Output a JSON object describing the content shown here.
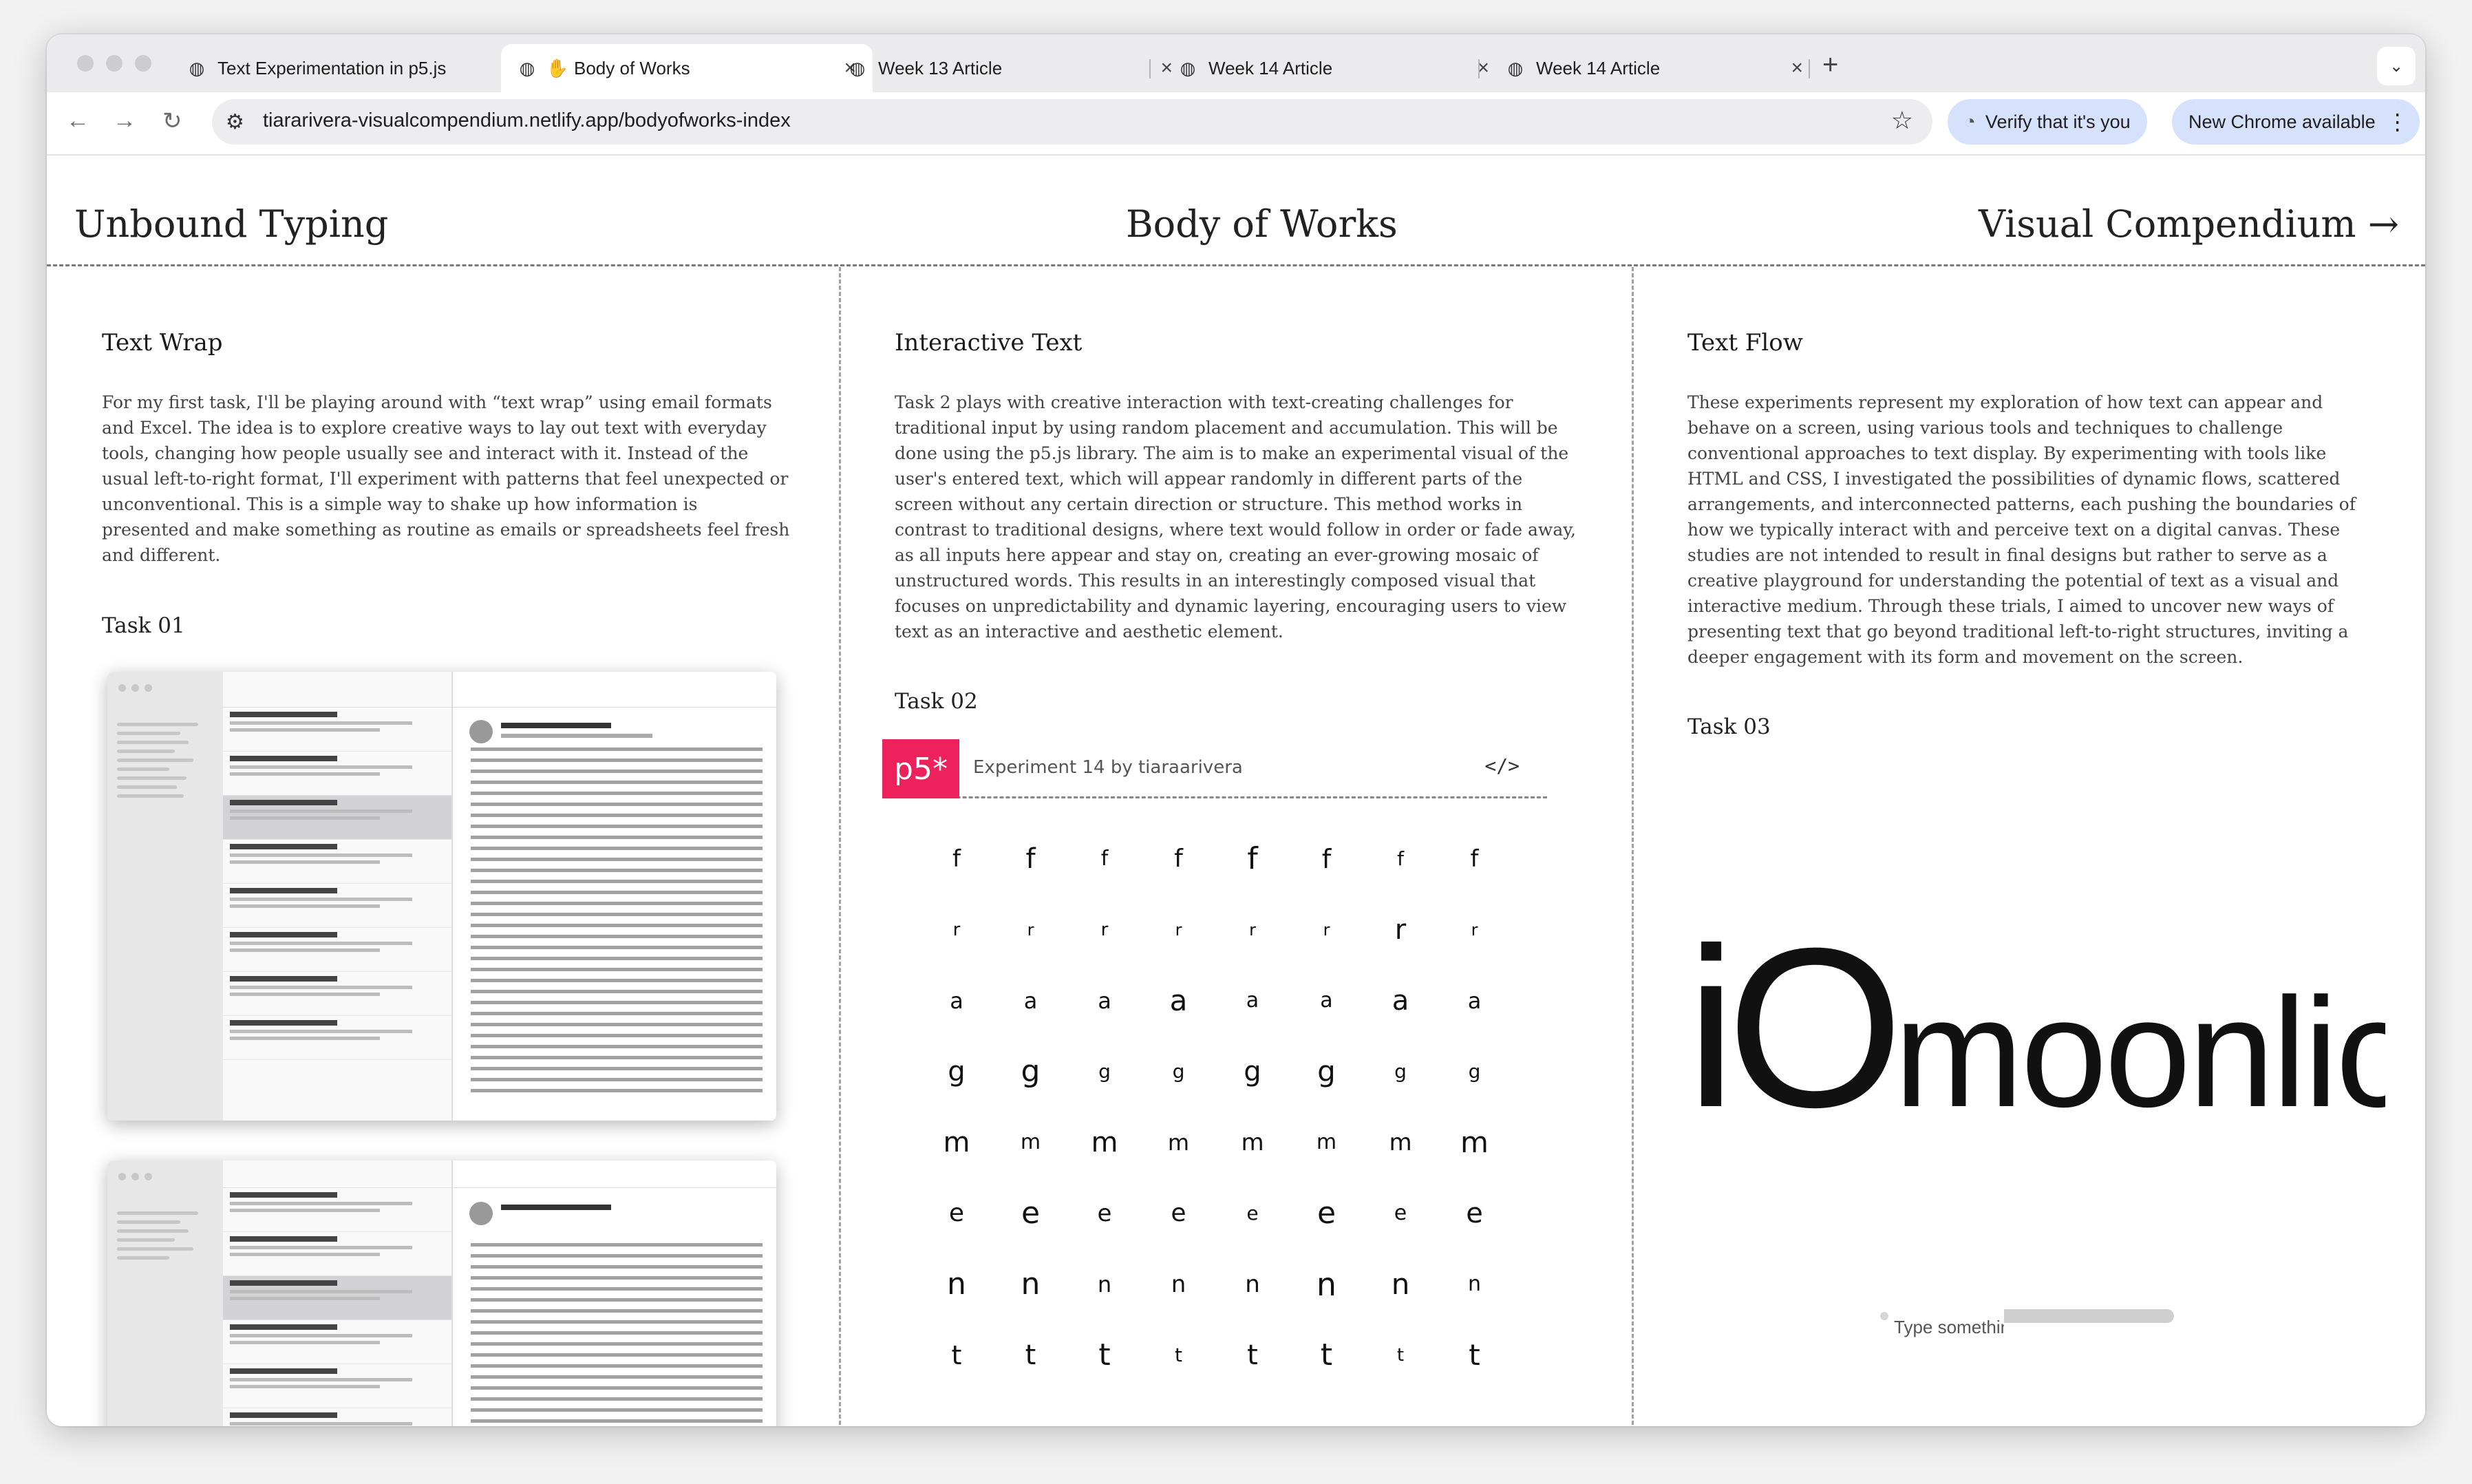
{
  "browser": {
    "tabs": [
      {
        "label": "Text Experimentation in p5.js",
        "icon": "globe-icon",
        "active": false
      },
      {
        "label": "Body of Works",
        "icon": "hand-icon",
        "active": true
      },
      {
        "label": "Week 13 Article",
        "icon": "globe-icon",
        "active": false
      },
      {
        "label": "Week 14 Article",
        "icon": "globe-icon",
        "active": false
      },
      {
        "label": "Week 14 Article",
        "icon": "globe-icon",
        "active": false
      }
    ],
    "url": "tiararivera-visualcompendium.netlify.app/bodyofworks-index",
    "verify_label": "Verify that it's you",
    "update_label": "New Chrome available"
  },
  "page": {
    "nav": {
      "left": "Unbound Typing",
      "center": "Body of Works",
      "right": "Visual Compendium →"
    },
    "columns": [
      {
        "title": "Text Wrap",
        "body": "For my first task, I'll be playing around with “text wrap” using email formats and Excel. The idea is to explore creative ways to lay out text with everyday tools, changing how people usually see and interact with it. Instead of the usual left-to-right format, I'll experiment with patterns that feel unexpected or unconventional. This is a simple way to shake up how information is presented and make something as routine as emails or spreadsheets feel fresh and different.",
        "task": "Task 01"
      },
      {
        "title": "Interactive Text",
        "body": "Task 2 plays with creative interaction with text-creating challenges for traditional input by using random placement and accumulation. This will be done using the p5.js library. The aim is to make an experimental visual of the user's entered text, which will appear randomly in different parts of the screen without any certain direction or structure. This method works in contrast to traditional designs, where text would follow in order or fade away, as all inputs here appear and stay on, creating an ever-growing mosaic of unstructured words. This results in an interestingly composed visual that focuses on unpredictability and dynamic layering, encouraging users to view text as an interactive and aesthetic element.",
        "task": "Task 02"
      },
      {
        "title": "Text Flow",
        "body": "These experiments represent my exploration of how text can appear and behave on a screen, using various tools and techniques to challenge conventional approaches to text display. By experimenting with tools like HTML and CSS, I investigated the possibilities of dynamic flows, scattered arrangements, and interconnected patterns, each pushing the boundaries of how we typically interact with and perceive text on a digital canvas. These studies are not intended to result in final designs but rather to serve as a creative playground for understanding the potential of text as a visual and interactive medium. Through these trials, I aimed to uncover new ways of presenting text that go beyond traditional left-to-right structures, inviting a deeper engagement with its form and movement on the screen.",
        "task": "Task 03"
      }
    ],
    "p5_embed": {
      "logo": "p5*",
      "title": "Experiment 14  by  tiaraarivera",
      "code_icon": "</>",
      "rows": [
        "f",
        "r",
        "a",
        "g",
        "m",
        "e",
        "n",
        "t"
      ]
    },
    "task03": {
      "big_i": "iO",
      "big_rest": "moonlic",
      "placeholder": "Type something"
    }
  }
}
